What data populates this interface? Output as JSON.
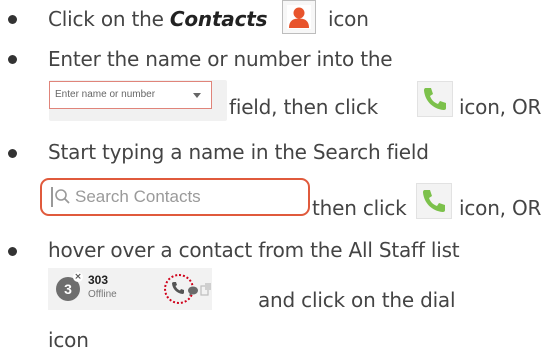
{
  "step1": {
    "prefix": "Click on the",
    "bold": "Contacts",
    "suffix": "icon"
  },
  "step2": {
    "line1": "Enter the name or number into the",
    "field_placeholder": "Enter name or number",
    "line2": "field, then click",
    "line2_end": "icon, OR"
  },
  "step3": {
    "line1": "Start typing a name in the Search field",
    "search_placeholder": "Search Contacts",
    "line2": "then click",
    "line2_end": "icon, OR"
  },
  "step4": {
    "line1": "hover over a contact from the All Staff list",
    "contact_count": "3",
    "contact_number": "303",
    "contact_status": "Offline",
    "line2": "and click on the dial",
    "line3": "icon"
  },
  "colors": {
    "accent_red": "#e05a3c",
    "call_green": "#7cc14b",
    "contacts_orange": "#e8542c"
  }
}
